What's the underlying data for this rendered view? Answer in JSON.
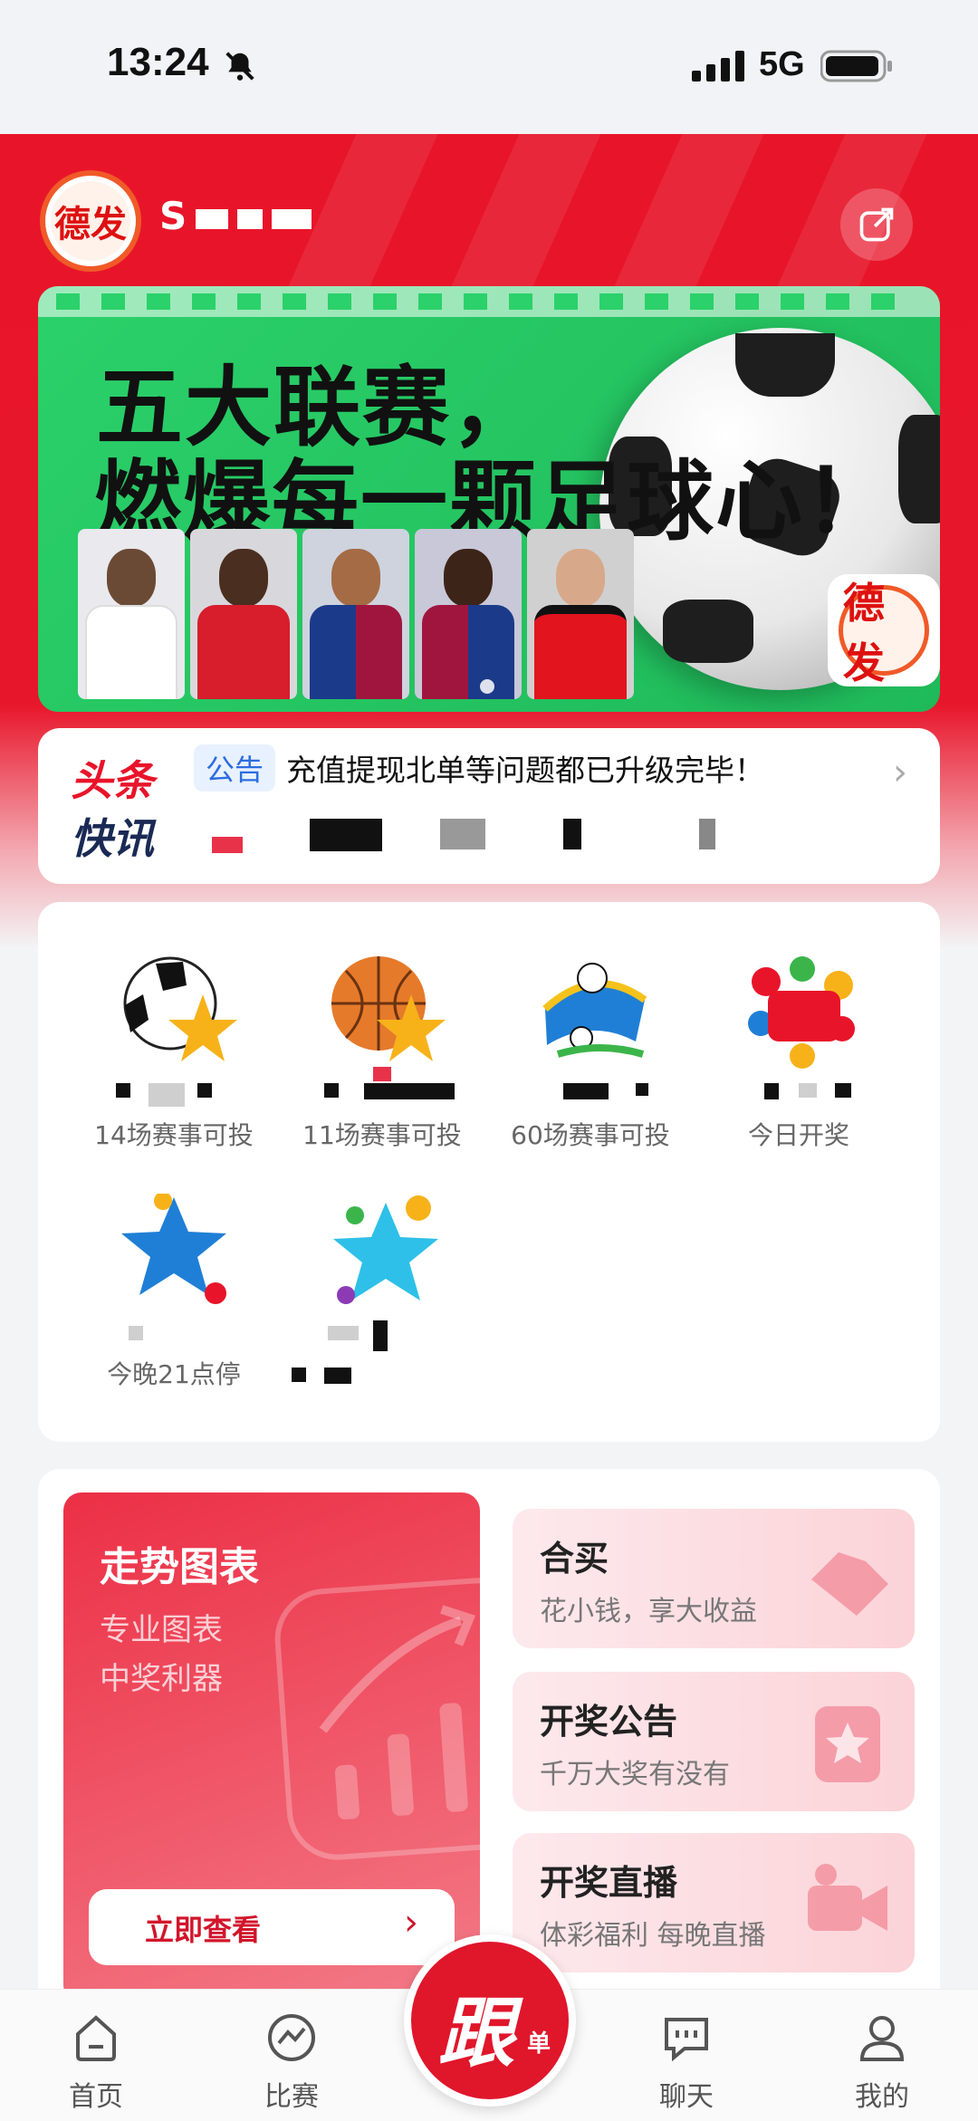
{
  "status_bar": {
    "time": "13:24",
    "network": "5G"
  },
  "header": {
    "app_name_prefix": "S",
    "logo_text": "德发"
  },
  "banner": {
    "line1": "五大联赛，",
    "line2": "燃爆每一颗足球心！",
    "badge_text": "德发"
  },
  "news": {
    "label_top": "头条",
    "label_bottom": "快讯",
    "tag": "公告",
    "text": "充值提现北单等问题都已升级完毕！"
  },
  "lottery": [
    {
      "subtitle": "14场赛事可投",
      "icon": "football-star-icon"
    },
    {
      "subtitle": "11场赛事可投",
      "icon": "basketball-star-icon"
    },
    {
      "subtitle": "60场赛事可投",
      "icon": "beidan-icon"
    },
    {
      "subtitle": "今日开奖",
      "icon": "daletou-icon"
    },
    {
      "subtitle": "今晚21点停",
      "icon": "pailie3-icon",
      "badge": "排列3"
    },
    {
      "subtitle": "",
      "icon": "pailie5-icon",
      "badge": "排列5"
    }
  ],
  "tools": {
    "trend": {
      "title": "走势图表",
      "line1": "专业图表",
      "line2": "中奖利器",
      "button": "立即查看"
    },
    "cards": [
      {
        "title": "合买",
        "subtitle": "花小钱，享大收益"
      },
      {
        "title": "开奖公告",
        "subtitle": "千万大奖有没有"
      },
      {
        "title": "开奖直播",
        "subtitle": "体彩福利 每晚直播"
      }
    ]
  },
  "tabbar": {
    "home": "首页",
    "match": "比赛",
    "follow_big": "跟",
    "follow_small": "单",
    "chat": "聊天",
    "mine": "我的"
  },
  "colors": {
    "brand_red": "#e8152a",
    "banner_green": "#2bd16a",
    "notice_blue": "#2d6de0"
  }
}
